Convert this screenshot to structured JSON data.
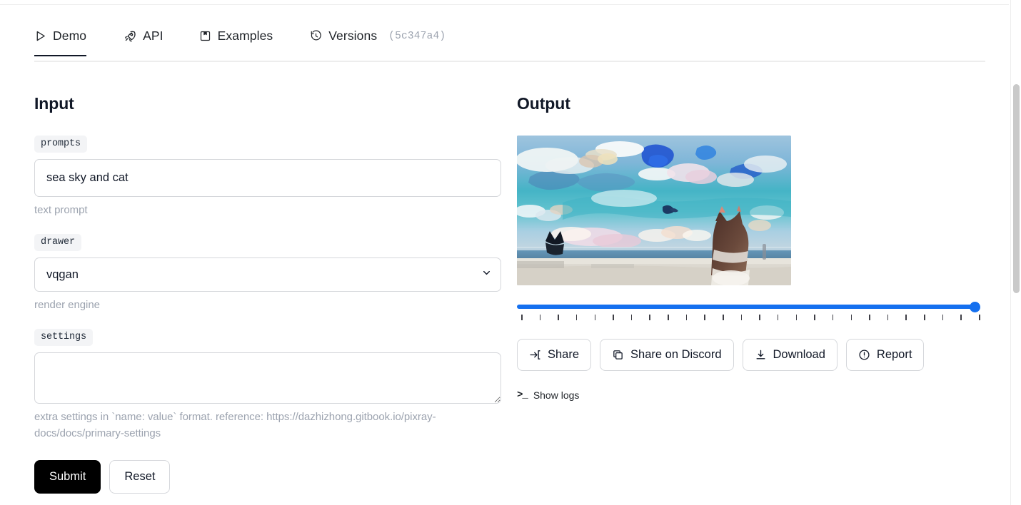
{
  "tabs": [
    {
      "label": "Demo",
      "icon": "play-triangle-icon",
      "active": true
    },
    {
      "label": "API",
      "icon": "rocket-icon",
      "active": false
    },
    {
      "label": "Examples",
      "icon": "bookmark-square-icon",
      "active": false
    },
    {
      "label": "Versions",
      "icon": "history-clock-icon",
      "active": false,
      "hash": "(5c347a4)"
    }
  ],
  "input": {
    "title": "Input",
    "prompts": {
      "label": "prompts",
      "value": "sea sky and cat",
      "placeholder": "",
      "helper": "text prompt"
    },
    "drawer": {
      "label": "drawer",
      "value": "vqgan",
      "options": [
        "vqgan"
      ],
      "helper": "render engine"
    },
    "settings": {
      "label": "settings",
      "value": "",
      "placeholder": "",
      "helper": "extra settings in `name: value` format. reference: https://dazhizhong.gitbook.io/pixray-docs/docs/primary-settings"
    },
    "submit_label": "Submit",
    "reset_label": "Reset"
  },
  "output": {
    "title": "Output",
    "image_alt": "generated watercolor painting of sea, sky and a cat",
    "slider": {
      "value": 100,
      "min": 0,
      "max": 100,
      "tick_count": 26
    },
    "actions": [
      {
        "label": "Share",
        "icon": "share-arrow-icon"
      },
      {
        "label": "Share on Discord",
        "icon": "copy-icon"
      },
      {
        "label": "Download",
        "icon": "download-icon"
      },
      {
        "label": "Report",
        "icon": "alert-circle-icon"
      }
    ],
    "logs": {
      "label": "Show logs",
      "glyph": ">_"
    }
  },
  "colors": {
    "accent_blue": "#1570ef",
    "submit_black": "#000000",
    "border_gray": "#d5d7db",
    "chip_bg": "#f3f4f6",
    "helper_gray": "#9ca3af"
  }
}
